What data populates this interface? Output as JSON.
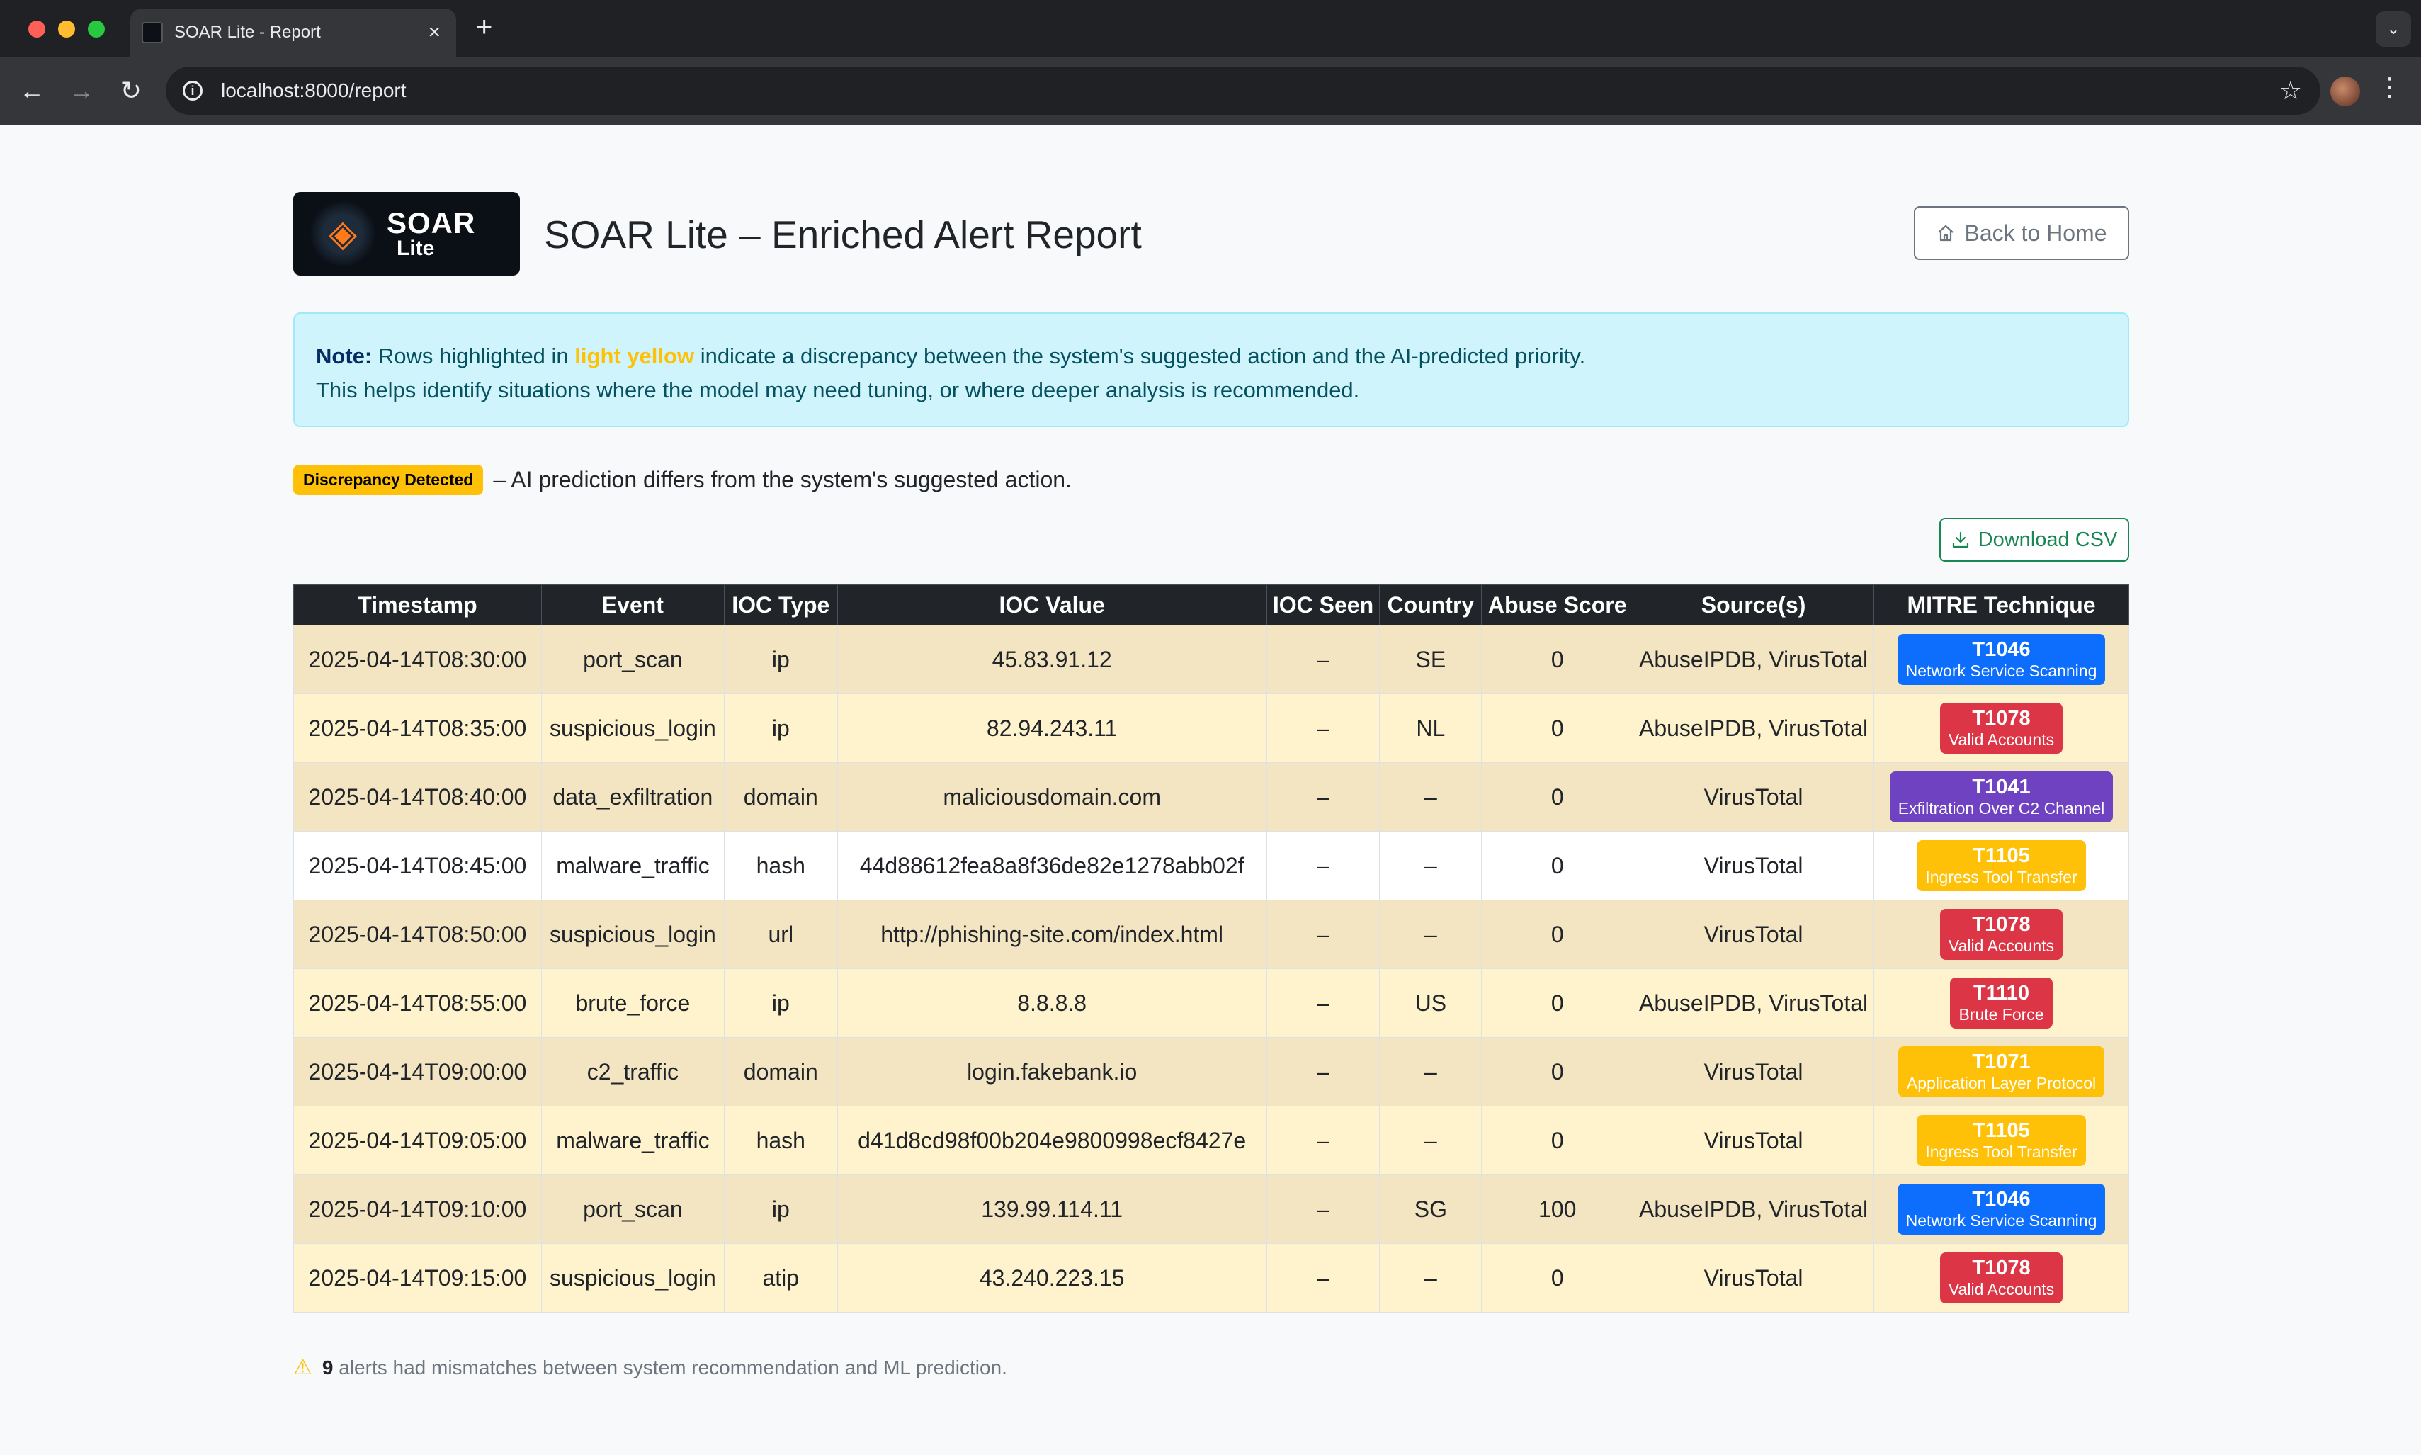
{
  "browser": {
    "tab_title": "SOAR Lite - Report",
    "url": "localhost:8000/report"
  },
  "header": {
    "logo_main": "SOAR",
    "logo_sub": "Lite",
    "title": "SOAR Lite – Enriched Alert Report",
    "back_label": "Back to Home"
  },
  "note": {
    "label": "Note:",
    "text_1": " Rows highlighted in ",
    "highlight": "light yellow",
    "text_2": " indicate a discrepancy between the system's suggested action and the AI-predicted priority.",
    "line_2": "This helps identify situations where the model may need tuning, or where deeper analysis is recommended."
  },
  "legend": {
    "badge": "Discrepancy Detected",
    "text": "– AI prediction differs from the system's suggested action."
  },
  "download_label": "Download CSV",
  "table": {
    "headers": [
      "Timestamp",
      "Event",
      "IOC Type",
      "IOC Value",
      "IOC Seen",
      "Country",
      "Abuse Score",
      "Source(s)",
      "MITRE Technique"
    ],
    "rows": [
      {
        "ts": "2025-04-14T08:30:00",
        "event": "port_scan",
        "ioc_type": "ip",
        "ioc_value": "45.83.91.12",
        "seen": "–",
        "country": "SE",
        "score": "0",
        "source": "AbuseIPDB, VirusTotal",
        "mitre_id": "T1046",
        "mitre_name": "Network Service Scanning",
        "mitre_color": "#0d6efd",
        "discrepancy": true
      },
      {
        "ts": "2025-04-14T08:35:00",
        "event": "suspicious_login",
        "ioc_type": "ip",
        "ioc_value": "82.94.243.11",
        "seen": "–",
        "country": "NL",
        "score": "0",
        "source": "AbuseIPDB, VirusTotal",
        "mitre_id": "T1078",
        "mitre_name": "Valid Accounts",
        "mitre_color": "#dc3545",
        "discrepancy": true
      },
      {
        "ts": "2025-04-14T08:40:00",
        "event": "data_exfiltration",
        "ioc_type": "domain",
        "ioc_value": "maliciousdomain.com",
        "seen": "–",
        "country": "–",
        "score": "0",
        "source": "VirusTotal",
        "mitre_id": "T1041",
        "mitre_name": "Exfiltration Over C2 Channel",
        "mitre_color": "#6f42c1",
        "discrepancy": true
      },
      {
        "ts": "2025-04-14T08:45:00",
        "event": "malware_traffic",
        "ioc_type": "hash",
        "ioc_value": "44d88612fea8a8f36de82e1278abb02f",
        "seen": "–",
        "country": "–",
        "score": "0",
        "source": "VirusTotal",
        "mitre_id": "T1105",
        "mitre_name": "Ingress Tool Transfer",
        "mitre_color": "#ffc107",
        "discrepancy": false
      },
      {
        "ts": "2025-04-14T08:50:00",
        "event": "suspicious_login",
        "ioc_type": "url",
        "ioc_value": "http://phishing-site.com/index.html",
        "seen": "–",
        "country": "–",
        "score": "0",
        "source": "VirusTotal",
        "mitre_id": "T1078",
        "mitre_name": "Valid Accounts",
        "mitre_color": "#dc3545",
        "discrepancy": true
      },
      {
        "ts": "2025-04-14T08:55:00",
        "event": "brute_force",
        "ioc_type": "ip",
        "ioc_value": "8.8.8.8",
        "seen": "–",
        "country": "US",
        "score": "0",
        "source": "AbuseIPDB, VirusTotal",
        "mitre_id": "T1110",
        "mitre_name": "Brute Force",
        "mitre_color": "#dc3545",
        "discrepancy": true
      },
      {
        "ts": "2025-04-14T09:00:00",
        "event": "c2_traffic",
        "ioc_type": "domain",
        "ioc_value": "login.fakebank.io",
        "seen": "–",
        "country": "–",
        "score": "0",
        "source": "VirusTotal",
        "mitre_id": "T1071",
        "mitre_name": "Application Layer Protocol",
        "mitre_color": "#ffc107",
        "discrepancy": true
      },
      {
        "ts": "2025-04-14T09:05:00",
        "event": "malware_traffic",
        "ioc_type": "hash",
        "ioc_value": "d41d8cd98f00b204e9800998ecf8427e",
        "seen": "–",
        "country": "–",
        "score": "0",
        "source": "VirusTotal",
        "mitre_id": "T1105",
        "mitre_name": "Ingress Tool Transfer",
        "mitre_color": "#ffc107",
        "discrepancy": true
      },
      {
        "ts": "2025-04-14T09:10:00",
        "event": "port_scan",
        "ioc_type": "ip",
        "ioc_value": "139.99.114.11",
        "seen": "–",
        "country": "SG",
        "score": "100",
        "source": "AbuseIPDB, VirusTotal",
        "mitre_id": "T1046",
        "mitre_name": "Network Service Scanning",
        "mitre_color": "#0d6efd",
        "discrepancy": true
      },
      {
        "ts": "2025-04-14T09:15:00",
        "event": "suspicious_login",
        "ioc_type": "atip",
        "ioc_value": "43.240.223.15",
        "seen": "–",
        "country": "–",
        "score": "0",
        "source": "VirusTotal",
        "mitre_id": "T1078",
        "mitre_name": "Valid Accounts",
        "mitre_color": "#dc3545",
        "discrepancy": true
      }
    ]
  },
  "footer": {
    "count": "9",
    "text": "alerts had mismatches between system recommendation and ML prediction."
  }
}
